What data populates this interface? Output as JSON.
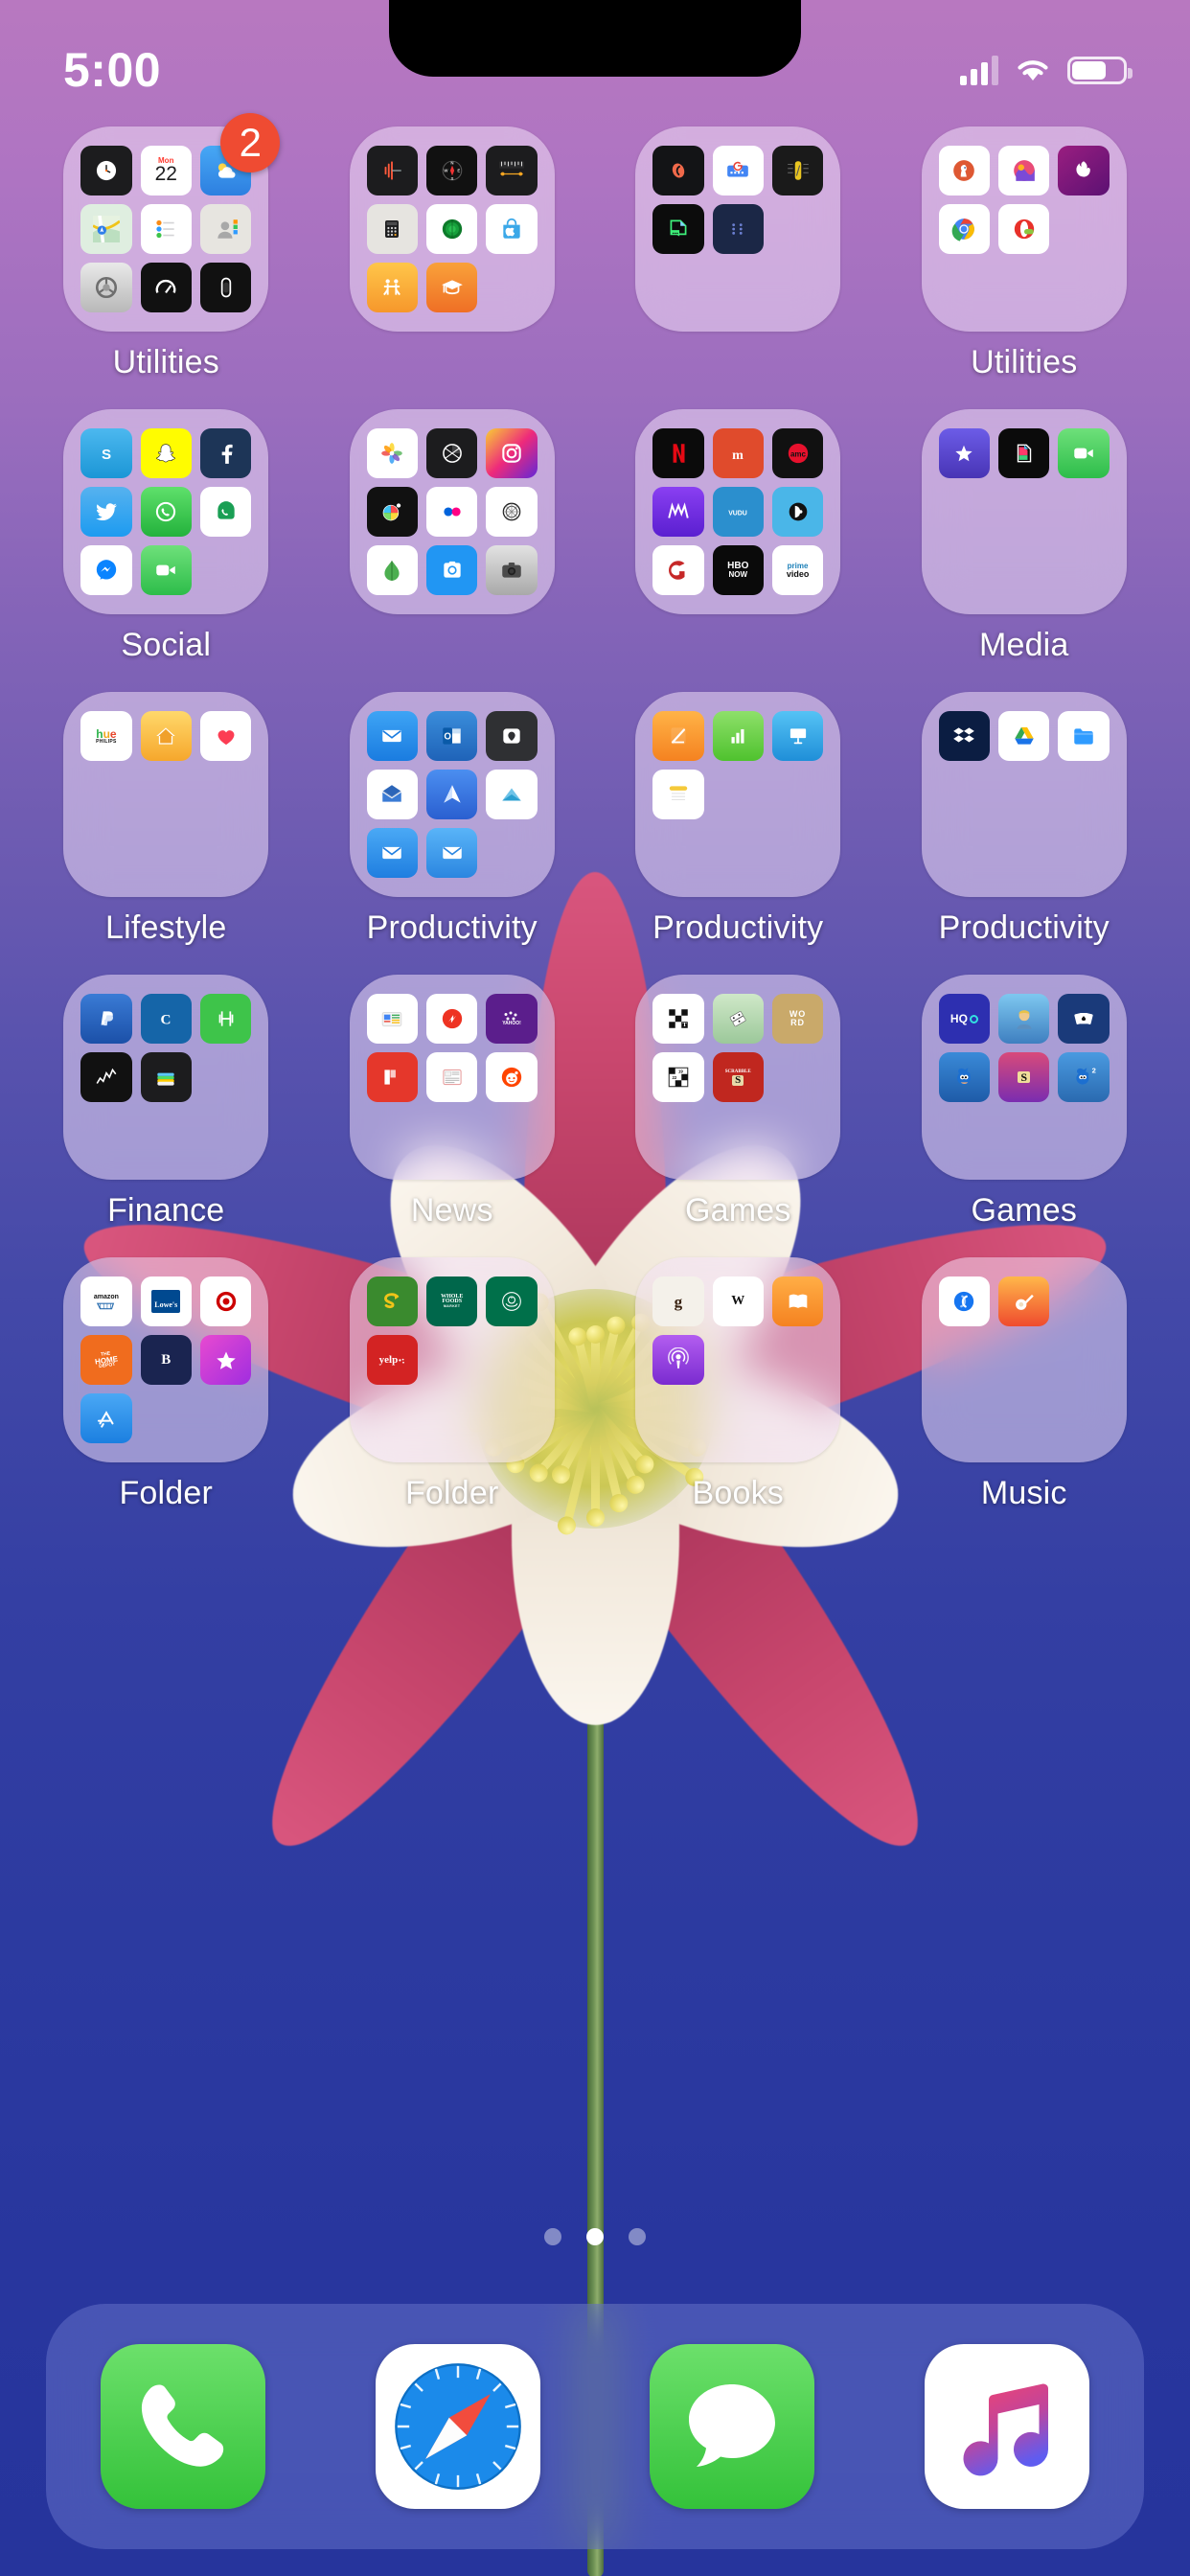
{
  "status_bar": {
    "time": "5:00",
    "cellular_icon": "cellular-signal-icon",
    "wifi_icon": "wifi-icon",
    "battery_icon": "battery-icon"
  },
  "page_indicator": {
    "total": 3,
    "active_index": 1
  },
  "home_grid": {
    "rows": 5,
    "columns": 4,
    "folders": [
      {
        "label": "Utilities",
        "badge": "2",
        "apps": [
          "Clock",
          "Calendar",
          "Weather",
          "Maps",
          "Reminders",
          "Contacts",
          "Settings",
          "Speedtest",
          "Watch"
        ]
      },
      {
        "label": "",
        "badge": "",
        "apps": [
          "Voice Memos",
          "Compass",
          "Measure",
          "Calculator",
          "Find My",
          "Apple Store",
          "Find Friends",
          "Apple Support"
        ]
      },
      {
        "label": "",
        "badge": "",
        "apps": [
          "Shazam Lite",
          "Gboard",
          "Tuner",
          "Notes Scanner",
          "Braille"
        ]
      },
      {
        "label": "Utilities",
        "badge": "",
        "apps": [
          "DuckDuckGo",
          "Ecosia",
          "Firefox Focus",
          "Chrome",
          "Opera Mini"
        ]
      },
      {
        "label": "Social",
        "badge": "",
        "apps": [
          "Skype",
          "Snapchat",
          "Facebook",
          "Twitter",
          "WhatsApp",
          "Google Voice",
          "Messenger",
          "FaceTime"
        ]
      },
      {
        "label": "",
        "badge": "",
        "apps": [
          "Photos",
          "Halide",
          "Instagram",
          "Afterlight",
          "Flickr",
          "Darkroom",
          "Snapseed",
          "Google Photos",
          "Camera"
        ]
      },
      {
        "label": "",
        "badge": "",
        "apps": [
          "Netflix",
          "Movies Anywhere",
          "AMC",
          "Max Go",
          "Vudu",
          "PBS",
          "Crackle",
          "HBO NOW",
          "Prime Video"
        ]
      },
      {
        "label": "Media",
        "badge": "",
        "apps": [
          "iMovie",
          "Clips",
          "FaceTime"
        ]
      },
      {
        "label": "Lifestyle",
        "badge": "",
        "apps": [
          "Philips Hue",
          "Home",
          "Health"
        ]
      },
      {
        "label": "Productivity",
        "badge": "",
        "apps": [
          "Mail",
          "Outlook",
          "Spark",
          "Edison Mail",
          "Airmail",
          "Polymail",
          "Gmail",
          "Yahoo Mail"
        ]
      },
      {
        "label": "Productivity",
        "badge": "",
        "apps": [
          "Pages",
          "Numbers",
          "Keynote",
          "Notes"
        ]
      },
      {
        "label": "Productivity",
        "badge": "",
        "apps": [
          "Dropbox",
          "Google Drive",
          "Files"
        ]
      },
      {
        "label": "Finance",
        "badge": "",
        "apps": [
          "PayPal",
          "Chase",
          "H&R Block",
          "Stocks",
          "Wallet"
        ]
      },
      {
        "label": "News",
        "badge": "",
        "apps": [
          "Google News",
          "SmartNews",
          "Yahoo",
          "Flipboard",
          "Apple News",
          "Reddit"
        ]
      },
      {
        "label": "Games",
        "badge": "",
        "apps": [
          "NYT Crossword",
          "Dominoes",
          "Word Cookies",
          "Crosswords",
          "Scrabble"
        ]
      },
      {
        "label": "Games",
        "badge": "",
        "apps": [
          "HQ Trivia",
          "Fortnite",
          "Solitaire",
          "Sonic",
          "Scrabble GO",
          "Sonic 2"
        ]
      },
      {
        "label": "Folder",
        "badge": "",
        "apps": [
          "Amazon",
          "Lowe's",
          "Target",
          "Home Depot",
          "Barnes & Noble",
          "Macy's",
          "App Store"
        ]
      },
      {
        "label": "Folder",
        "badge": "",
        "apps": [
          "Subway",
          "Whole Foods",
          "Starbucks",
          "Yelp"
        ]
      },
      {
        "label": "Books",
        "badge": "",
        "apps": [
          "Goodreads",
          "Wikipedia",
          "Books",
          "Podcasts"
        ]
      },
      {
        "label": "Music",
        "badge": "",
        "apps": [
          "Shazam",
          "GarageBand"
        ]
      }
    ]
  },
  "dock": {
    "apps": [
      {
        "name": "Phone",
        "icon": "phone-icon"
      },
      {
        "name": "Safari",
        "icon": "safari-compass-icon"
      },
      {
        "name": "Messages",
        "icon": "messages-bubble-icon"
      },
      {
        "name": "Music",
        "icon": "music-note-icon"
      }
    ]
  },
  "colors": {
    "badge_red": "#ef4b32",
    "folder_tint": "rgba(244,226,250,0.52)",
    "dock_tint": "rgba(150,160,235,0.30)",
    "wallpaper_top": "#b878c0",
    "wallpaper_bottom": "#26349c"
  }
}
